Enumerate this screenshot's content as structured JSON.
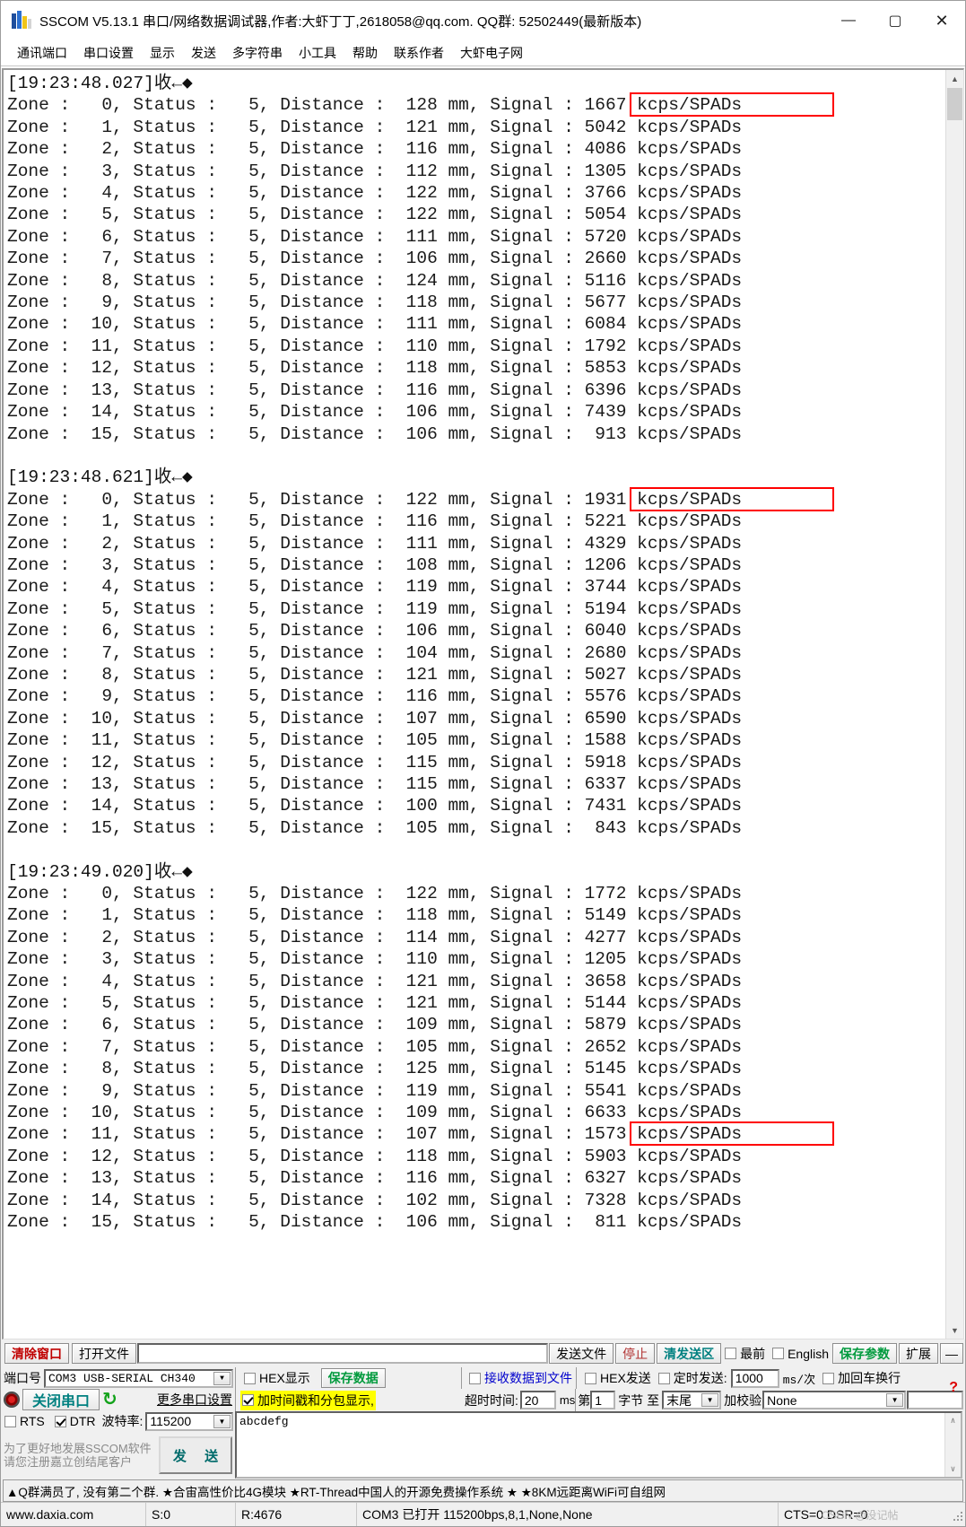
{
  "window": {
    "title": "SSCOM V5.13.1 串口/网络数据调试器,作者:大虾丁丁,2618058@qq.com. QQ群: 52502449(最新版本)",
    "minimize": "—",
    "maximize": "▢",
    "close": "✕"
  },
  "menu": {
    "items": [
      "通讯端口",
      "串口设置",
      "显示",
      "发送",
      "多字符串",
      "小工具",
      "帮助",
      "联系作者",
      "大虾电子网"
    ]
  },
  "terminal": {
    "blocks": [
      {
        "header": "[19:23:48.027]收←◆",
        "rows": [
          {
            "zone": "0",
            "status": "5",
            "distance": "128",
            "signal": "1667",
            "highlight": true
          },
          {
            "zone": "1",
            "status": "5",
            "distance": "121",
            "signal": "5042",
            "highlight": false
          },
          {
            "zone": "2",
            "status": "5",
            "distance": "116",
            "signal": "4086",
            "highlight": false
          },
          {
            "zone": "3",
            "status": "5",
            "distance": "112",
            "signal": "1305",
            "highlight": false
          },
          {
            "zone": "4",
            "status": "5",
            "distance": "122",
            "signal": "3766",
            "highlight": false
          },
          {
            "zone": "5",
            "status": "5",
            "distance": "122",
            "signal": "5054",
            "highlight": false
          },
          {
            "zone": "6",
            "status": "5",
            "distance": "111",
            "signal": "5720",
            "highlight": false
          },
          {
            "zone": "7",
            "status": "5",
            "distance": "106",
            "signal": "2660",
            "highlight": false
          },
          {
            "zone": "8",
            "status": "5",
            "distance": "124",
            "signal": "5116",
            "highlight": false
          },
          {
            "zone": "9",
            "status": "5",
            "distance": "118",
            "signal": "5677",
            "highlight": false
          },
          {
            "zone": "10",
            "status": "5",
            "distance": "111",
            "signal": "6084",
            "highlight": false
          },
          {
            "zone": "11",
            "status": "5",
            "distance": "110",
            "signal": "1792",
            "highlight": false
          },
          {
            "zone": "12",
            "status": "5",
            "distance": "118",
            "signal": "5853",
            "highlight": false
          },
          {
            "zone": "13",
            "status": "5",
            "distance": "116",
            "signal": "6396",
            "highlight": false
          },
          {
            "zone": "14",
            "status": "5",
            "distance": "106",
            "signal": "7439",
            "highlight": false
          },
          {
            "zone": "15",
            "status": "5",
            "distance": "106",
            "signal": "913",
            "highlight": false
          }
        ]
      },
      {
        "header": "[19:23:48.621]收←◆",
        "rows": [
          {
            "zone": "0",
            "status": "5",
            "distance": "122",
            "signal": "1931",
            "highlight": true
          },
          {
            "zone": "1",
            "status": "5",
            "distance": "116",
            "signal": "5221",
            "highlight": false
          },
          {
            "zone": "2",
            "status": "5",
            "distance": "111",
            "signal": "4329",
            "highlight": false
          },
          {
            "zone": "3",
            "status": "5",
            "distance": "108",
            "signal": "1206",
            "highlight": false
          },
          {
            "zone": "4",
            "status": "5",
            "distance": "119",
            "signal": "3744",
            "highlight": false
          },
          {
            "zone": "5",
            "status": "5",
            "distance": "119",
            "signal": "5194",
            "highlight": false
          },
          {
            "zone": "6",
            "status": "5",
            "distance": "106",
            "signal": "6040",
            "highlight": false
          },
          {
            "zone": "7",
            "status": "5",
            "distance": "104",
            "signal": "2680",
            "highlight": false
          },
          {
            "zone": "8",
            "status": "5",
            "distance": "121",
            "signal": "5027",
            "highlight": false
          },
          {
            "zone": "9",
            "status": "5",
            "distance": "116",
            "signal": "5576",
            "highlight": false
          },
          {
            "zone": "10",
            "status": "5",
            "distance": "107",
            "signal": "6590",
            "highlight": false
          },
          {
            "zone": "11",
            "status": "5",
            "distance": "105",
            "signal": "1588",
            "highlight": false
          },
          {
            "zone": "12",
            "status": "5",
            "distance": "115",
            "signal": "5918",
            "highlight": false
          },
          {
            "zone": "13",
            "status": "5",
            "distance": "115",
            "signal": "6337",
            "highlight": false
          },
          {
            "zone": "14",
            "status": "5",
            "distance": "100",
            "signal": "7431",
            "highlight": false
          },
          {
            "zone": "15",
            "status": "5",
            "distance": "105",
            "signal": "843",
            "highlight": false
          }
        ]
      },
      {
        "header": "[19:23:49.020]收←◆",
        "rows": [
          {
            "zone": "0",
            "status": "5",
            "distance": "122",
            "signal": "1772",
            "highlight": false
          },
          {
            "zone": "1",
            "status": "5",
            "distance": "118",
            "signal": "5149",
            "highlight": false
          },
          {
            "zone": "2",
            "status": "5",
            "distance": "114",
            "signal": "4277",
            "highlight": false
          },
          {
            "zone": "3",
            "status": "5",
            "distance": "110",
            "signal": "1205",
            "highlight": false
          },
          {
            "zone": "4",
            "status": "5",
            "distance": "121",
            "signal": "3658",
            "highlight": false
          },
          {
            "zone": "5",
            "status": "5",
            "distance": "121",
            "signal": "5144",
            "highlight": false
          },
          {
            "zone": "6",
            "status": "5",
            "distance": "109",
            "signal": "5879",
            "highlight": false
          },
          {
            "zone": "7",
            "status": "5",
            "distance": "105",
            "signal": "2652",
            "highlight": false
          },
          {
            "zone": "8",
            "status": "5",
            "distance": "125",
            "signal": "5145",
            "highlight": false
          },
          {
            "zone": "9",
            "status": "5",
            "distance": "119",
            "signal": "5541",
            "highlight": false
          },
          {
            "zone": "10",
            "status": "5",
            "distance": "109",
            "signal": "6633",
            "highlight": false
          },
          {
            "zone": "11",
            "status": "5",
            "distance": "107",
            "signal": "1573",
            "highlight": true
          },
          {
            "zone": "12",
            "status": "5",
            "distance": "118",
            "signal": "5903",
            "highlight": false
          },
          {
            "zone": "13",
            "status": "5",
            "distance": "116",
            "signal": "6327",
            "highlight": false
          },
          {
            "zone": "14",
            "status": "5",
            "distance": "102",
            "signal": "7328",
            "highlight": false
          },
          {
            "zone": "15",
            "status": "5",
            "distance": "106",
            "signal": "811",
            "highlight": false
          }
        ]
      }
    ],
    "labels": {
      "zone": "Zone :",
      "status": "Status :",
      "distance": "Distance :",
      "unit_mm": "mm,",
      "signal": "Signal :",
      "unit_signal": "kcps/SPADs"
    },
    "scrollbar": {
      "up": "▲",
      "down": "▼"
    }
  },
  "toolbar": {
    "clear_window": "清除窗口",
    "open_file": "打开文件",
    "file_path": "",
    "send_file": "发送文件",
    "stop": "停止",
    "clear_send": "清发送区",
    "topmost": "最前",
    "topmost_checked": false,
    "english": "English",
    "english_checked": false,
    "save_params": "保存参数",
    "extend": "扩展",
    "collapse": "—"
  },
  "port_panel": {
    "port_label": "端口号",
    "port_value": "COM3 USB-SERIAL CH340",
    "close_port": "关闭串口",
    "refresh_icon": "↻",
    "more_settings": "更多串口设置",
    "rts_label": "RTS",
    "rts_checked": false,
    "dtr_label": "DTR",
    "dtr_checked": true,
    "baud_label": "波特率:",
    "baud_value": "115200",
    "promo_line1": "为了更好地发展SSCOM软件",
    "promo_line2": "请您注册嘉立创结尾客户",
    "send_button": "发 送"
  },
  "recv_panel": {
    "hex_display": "HEX显示",
    "hex_display_checked": false,
    "save_data": "保存数据",
    "recv_to_file": "接收数据到文件",
    "recv_to_file_checked": false,
    "timestamp": "加时间戳和分包显示,",
    "timestamp_checked": true,
    "timeout_label": "超时时间:",
    "timeout_value": "20",
    "timeout_unit": "ms"
  },
  "send_panel": {
    "hex_send": "HEX发送",
    "hex_send_checked": false,
    "timed_send": "定时发送:",
    "timed_send_checked": false,
    "interval_value": "1000",
    "interval_unit": "ms/次",
    "crlf": "加回车换行",
    "crlf_checked": false,
    "help_icon": "?",
    "byte_prefix": "第",
    "byte_start": "1",
    "byte_label": "字节 至",
    "byte_end": "末尾",
    "checksum_label": "加校验",
    "checksum_value": "None",
    "checksum_extra": "",
    "send_text": "abcdefg"
  },
  "ad_bar": {
    "text": "▲Q群满员了, 没有第二个群. ★合宙高性价比4G模块 ★RT-Thread中国人的开源免费操作系统 ★ ★8KM远距离WiFi可自组网"
  },
  "status_bar": {
    "website": "www.daxia.com",
    "sent": "S:0",
    "received": "R:4676",
    "port_status": "COM3 已打开  115200bps,8,1,None,None",
    "signals": "CTS=0 DSR=0",
    "watermark": "CSDN @没记帖"
  }
}
